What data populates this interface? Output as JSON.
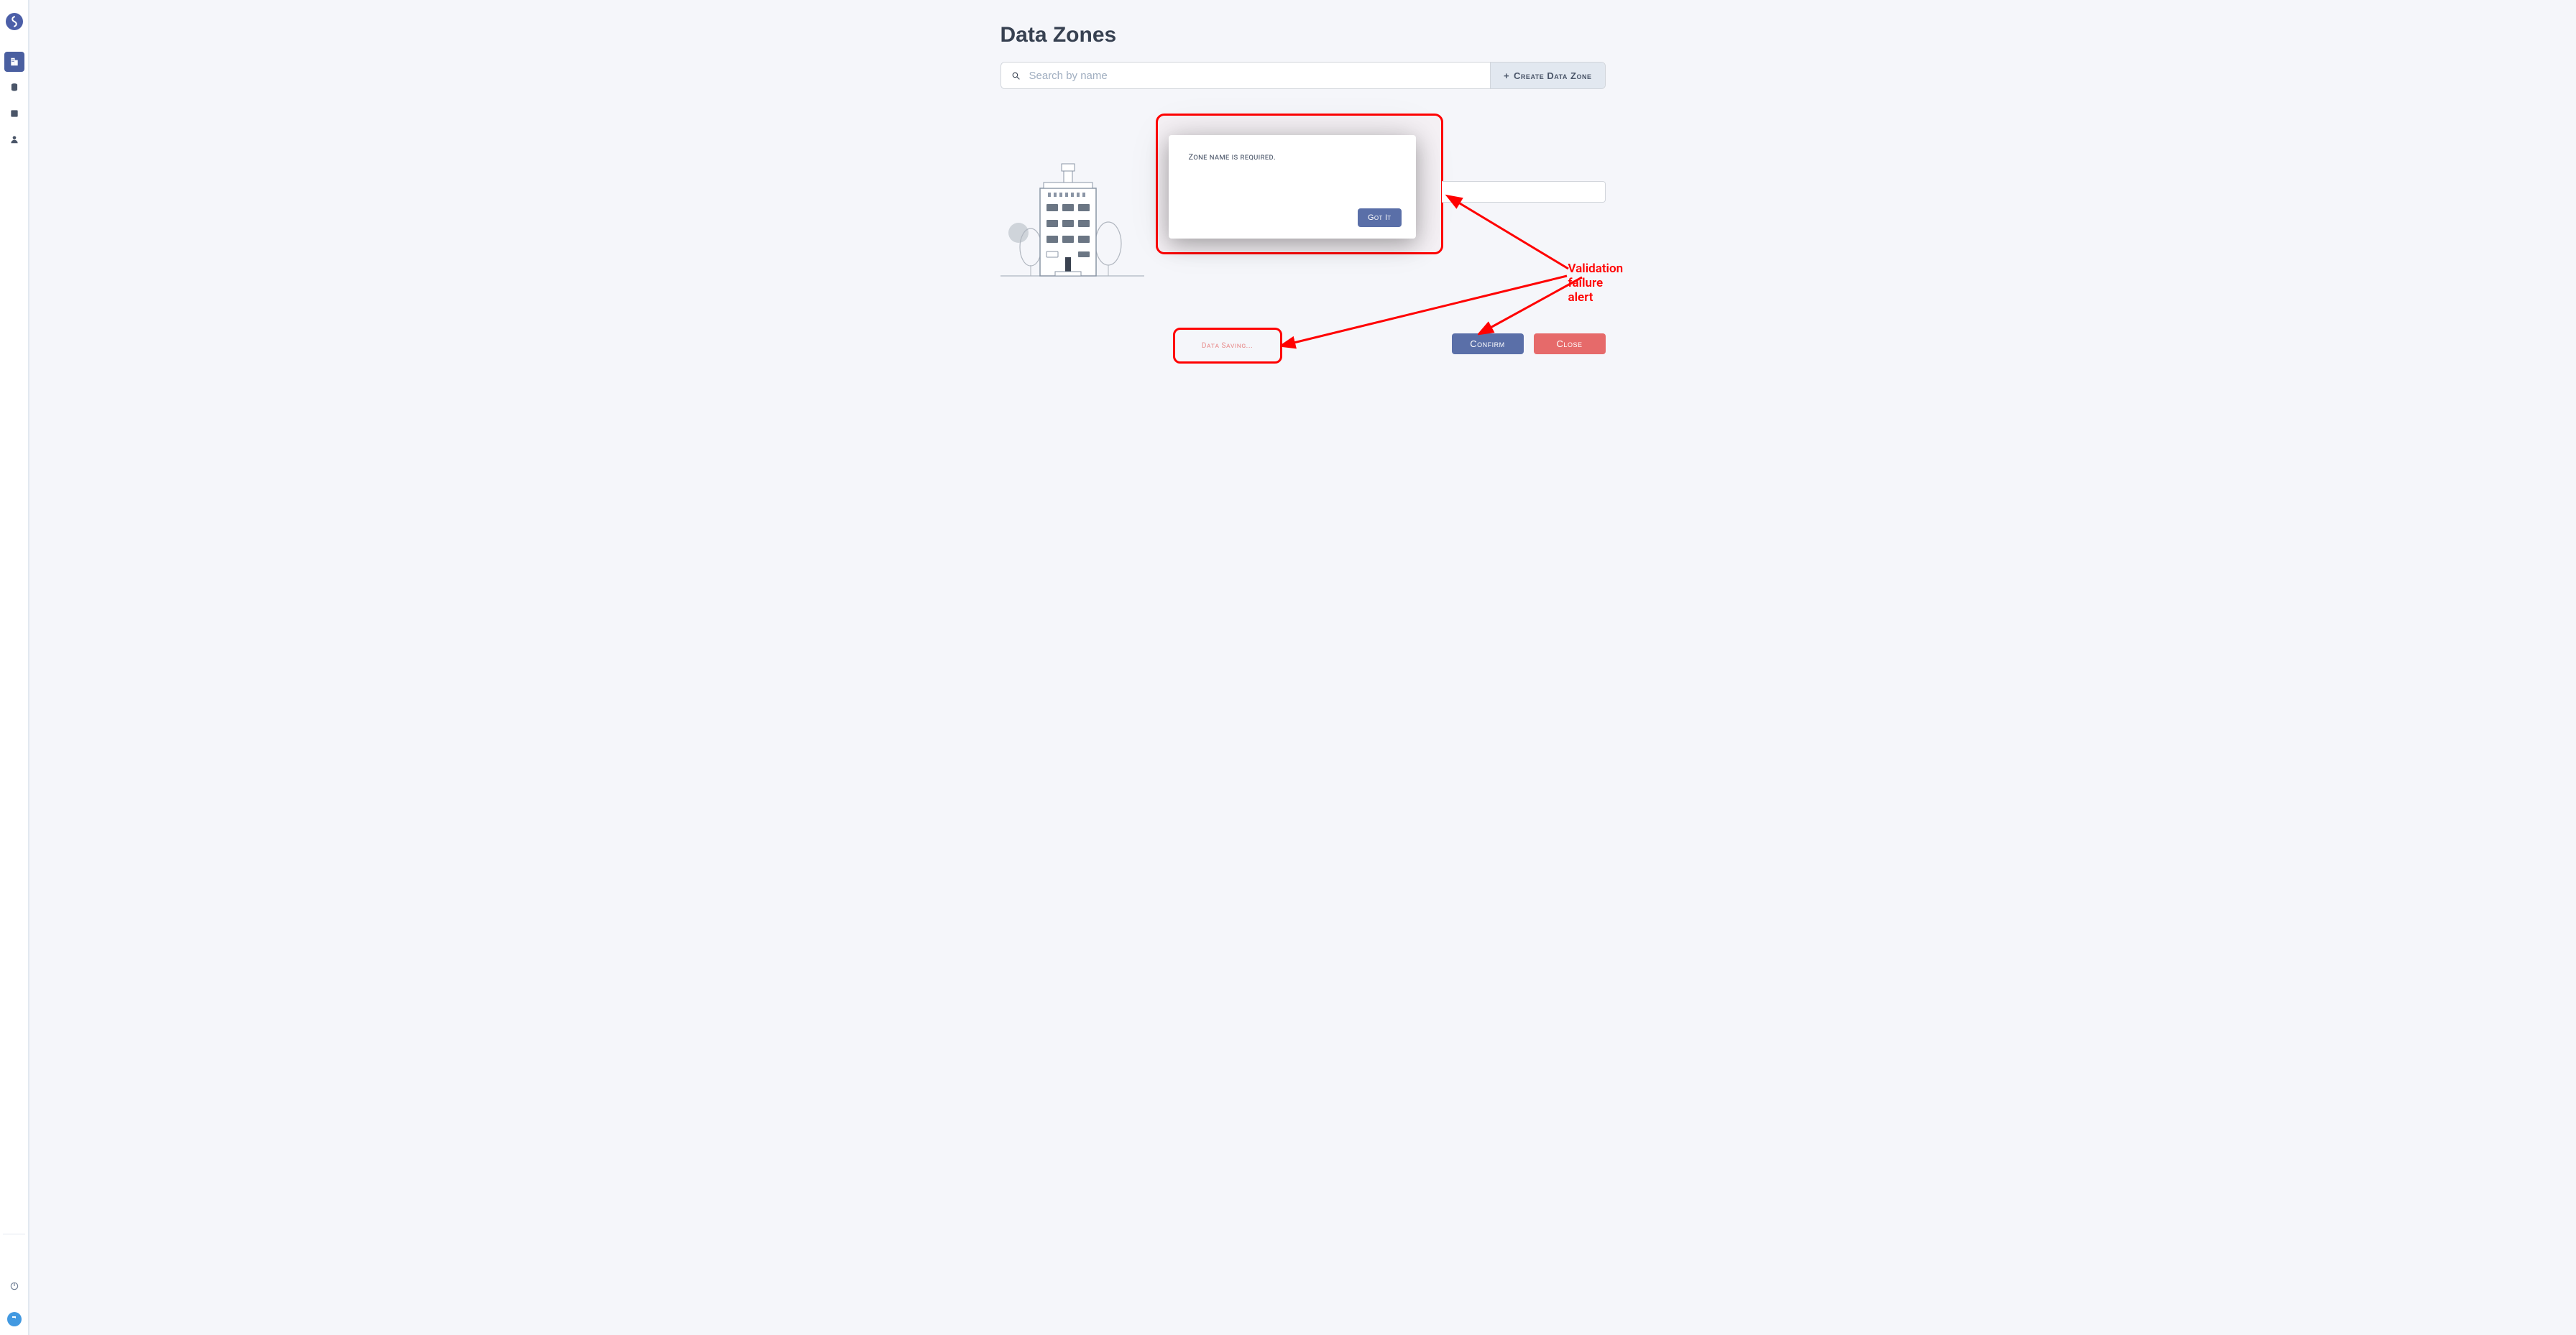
{
  "page_title": "Data Zones",
  "search": {
    "placeholder": "Search by name"
  },
  "create_button": {
    "plus": "+",
    "label": "Create Data Zone"
  },
  "modal": {
    "message": "Zone name is required.",
    "button": "Got It"
  },
  "saving_text": "Data Saving...",
  "actions": {
    "confirm": "Confirm",
    "close": "Close"
  },
  "annotations": {
    "validation_failure": "Validation failure alert"
  },
  "sidebar": {
    "logo_color": "#4c5fa8",
    "items": [
      {
        "name": "building-icon",
        "active": true
      },
      {
        "name": "database-icon",
        "active": false
      },
      {
        "name": "external-link-icon",
        "active": false
      },
      {
        "name": "user-icon",
        "active": false
      }
    ]
  },
  "colors": {
    "primary": "#5a6fa8",
    "danger": "#e66a6a",
    "highlight": "#ff0000"
  }
}
